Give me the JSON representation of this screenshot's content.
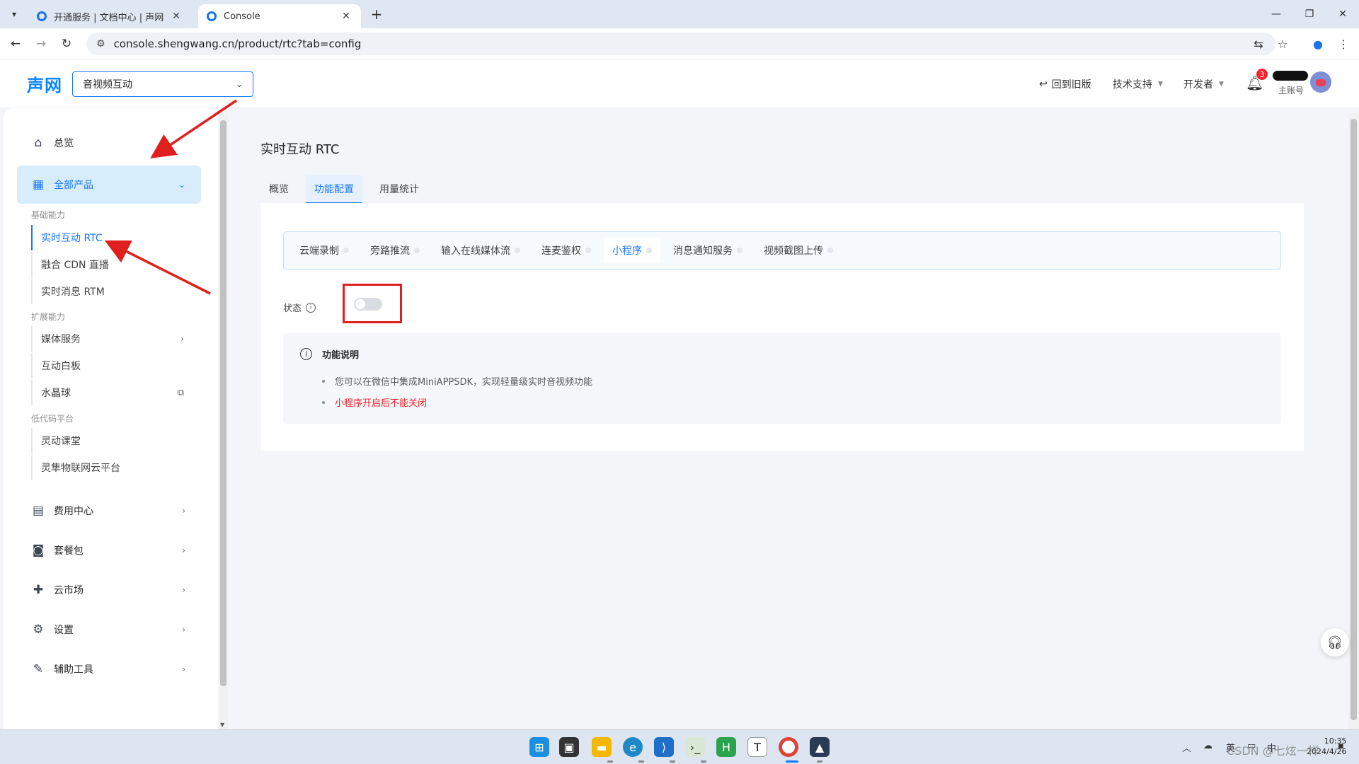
{
  "browser": {
    "tabs": [
      {
        "title": "开通服务 | 文档中心 | 声网",
        "active": false
      },
      {
        "title": "Console",
        "active": true
      }
    ],
    "url": "console.shengwang.cn/product/rtc?tab=config"
  },
  "header": {
    "logo": "声网",
    "product_select": "音视频互动",
    "back_old": "回到旧版",
    "tech_support": "技术支持",
    "developer": "开发者",
    "notification_count": "3",
    "account_label": "主账号"
  },
  "sidebar": {
    "overview": "总览",
    "all_products": "全部产品",
    "group_basic": "基础能力",
    "rtc": "实时互动 RTC",
    "cdn": "融合 CDN 直播",
    "rtm": "实时消息 RTM",
    "group_ext": "扩展能力",
    "media": "媒体服务",
    "whiteboard": "互动白板",
    "crystal_ball": "水晶球",
    "group_lowcode": "低代码平台",
    "classroom": "灵动课堂",
    "iot": "灵隼物联网云平台",
    "billing": "费用中心",
    "packages": "套餐包",
    "market": "云市场",
    "settings": "设置",
    "tools": "辅助工具"
  },
  "main": {
    "title": "实时互动 RTC",
    "tabs": [
      "概览",
      "功能配置",
      "用量统计"
    ],
    "active_tab": 1,
    "subtabs": [
      "云端录制",
      "旁路推流",
      "输入在线媒体流",
      "连麦鉴权",
      "小程序",
      "消息通知服务",
      "视频截图上传"
    ],
    "active_subtab": 4,
    "status_label": "状态",
    "toggle_on": false,
    "desc_title": "功能说明",
    "desc_items": [
      "您可以在微信中集成MiniAPPSDK，实现轻量级实时音视频功能"
    ],
    "desc_warning": "小程序开启后不能关闭"
  },
  "taskbar": {
    "time": "10:35",
    "date": "2024/4/26",
    "ime": "英",
    "ime2": "中"
  },
  "watermark": "CSDN @七炫一样",
  "colors": {
    "accent": "#1677ff",
    "active_bg": "#d8edfc",
    "warning": "#f5222d",
    "annotation_red": "#e01f1f"
  }
}
